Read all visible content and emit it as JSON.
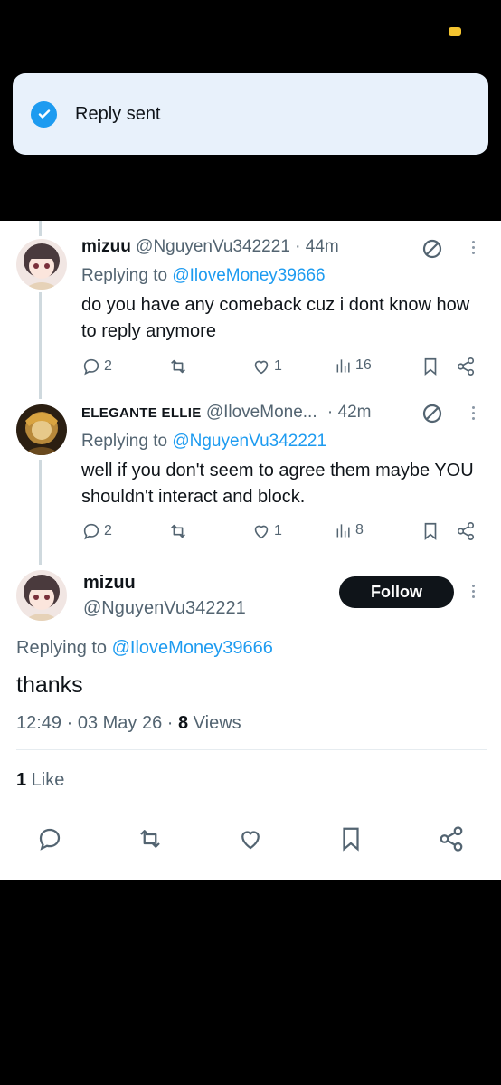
{
  "toast": {
    "message": "Reply sent"
  },
  "colors": {
    "accent": "#1d9bf0",
    "text": "#0f1419",
    "muted": "#536471",
    "follow_bg": "#0f1419"
  },
  "tweets": [
    {
      "name": "mizuu",
      "handle": "@NguyenVu342221",
      "time": "· 44m",
      "replying_prefix": "Replying to",
      "replying_to": "@IloveMoney39666",
      "text": "do you have any comeback cuz i dont know how to reply anymore",
      "replies": "2",
      "retweets": "",
      "likes": "1",
      "views": "16"
    },
    {
      "name": "ELEGANTE ELLIE",
      "handle": "@IloveMone...",
      "time": "· 42m",
      "replying_prefix": "Replying to",
      "replying_to": "@NguyenVu342221",
      "text": "well if you don't seem to agree them maybe YOU shouldn't interact and block.",
      "replies": "2",
      "retweets": "",
      "likes": "1",
      "views": "8"
    }
  ],
  "main": {
    "name": "mizuu",
    "handle": "@NguyenVu342221",
    "follow_label": "Follow",
    "replying_prefix": "Replying to",
    "replying_to": "@IloveMoney39666",
    "text": "thanks",
    "timestamp": "12:49 · 03 May 26 · ",
    "views_count": "8",
    "views_label": " Views",
    "likes_count": "1",
    "likes_label": " Like"
  },
  "icons": [
    "check-icon",
    "reply-icon",
    "retweet-icon",
    "like-icon",
    "views-icon",
    "bookmark-icon",
    "share-icon",
    "more-icon",
    "no-entry-icon"
  ]
}
